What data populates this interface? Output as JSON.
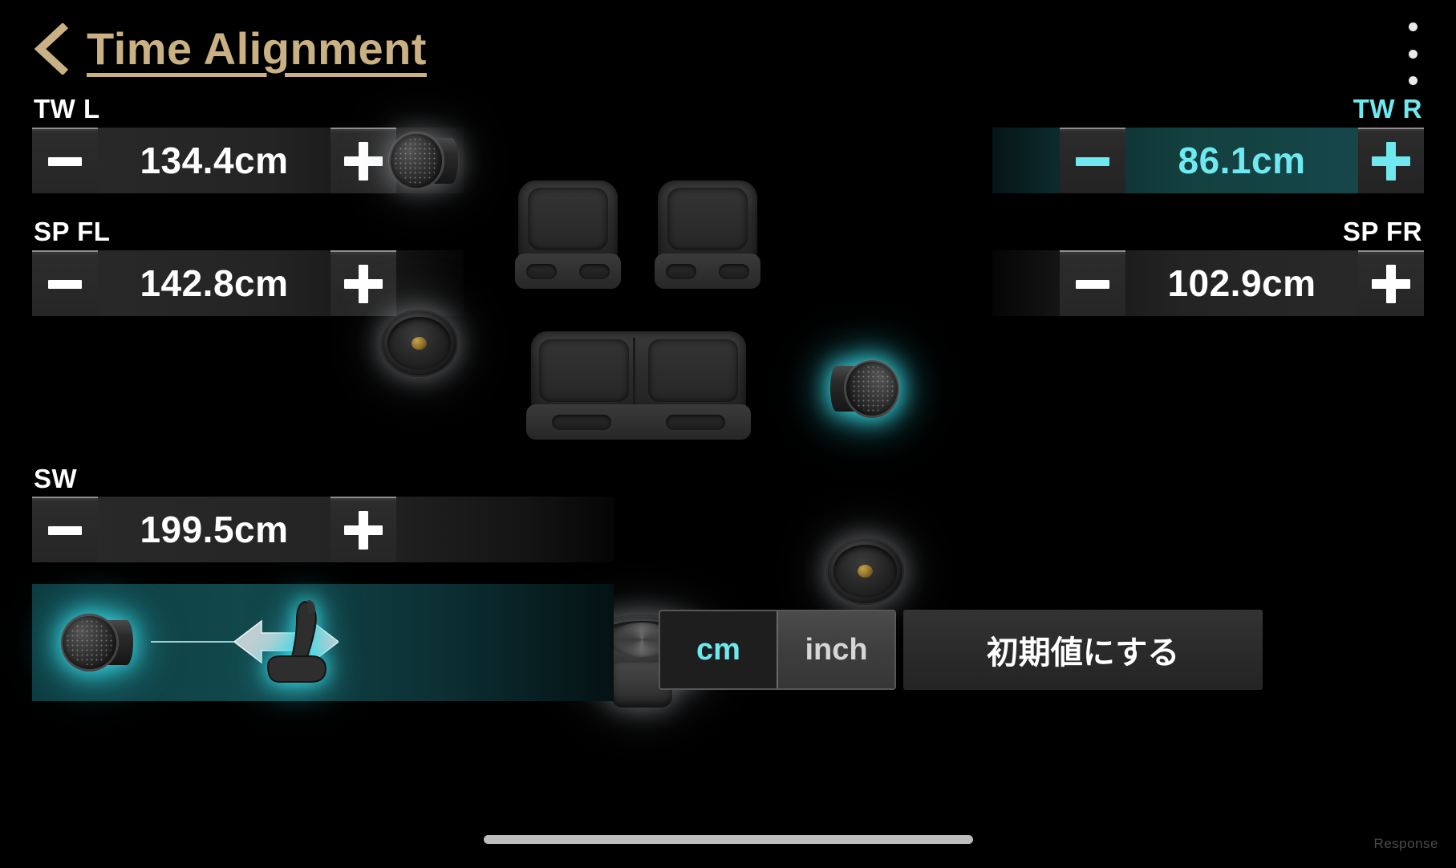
{
  "header": {
    "title": "Time Alignment",
    "back_icon": "chevron-left-icon",
    "menu_icon": "overflow-menu-icon"
  },
  "channels": {
    "tw_l": {
      "label": "TW L",
      "value": "134.4cm",
      "minus": "−",
      "plus": "+",
      "icon": "tweeter-icon",
      "active": false
    },
    "tw_r": {
      "label": "TW R",
      "value": "86.1cm",
      "minus": "−",
      "plus": "+",
      "icon": "tweeter-icon",
      "active": true
    },
    "sp_fl": {
      "label": "SP FL",
      "value": "142.8cm",
      "minus": "−",
      "plus": "+",
      "icon": "midwoofer-icon",
      "active": false
    },
    "sp_fr": {
      "label": "SP FR",
      "value": "102.9cm",
      "minus": "−",
      "plus": "+",
      "icon": "midwoofer-icon",
      "active": false
    },
    "sw": {
      "label": "SW",
      "value": "199.5cm",
      "minus": "−",
      "plus": "+",
      "icon": "subwoofer-icon",
      "active": false
    }
  },
  "diagram": {
    "speaker_icon": "tweeter-icon",
    "seat_icon": "car-seat-icon",
    "arrows_icon": "double-arrow-icon"
  },
  "units": {
    "cm_label": "cm",
    "inch_label": "inch",
    "selected": "cm"
  },
  "reset": {
    "label": "初期値にする"
  },
  "seats": {
    "front_left": "car-seat-front-left",
    "front_right": "car-seat-front-right",
    "rear": "car-seat-rear-bench"
  },
  "watermark": "Response",
  "colors": {
    "accent_cyan": "#6fe9ef",
    "title_gold": "#c9b183",
    "row_bg": "#2a2a2a",
    "active_row_bg": "#17494e",
    "background": "#000000"
  }
}
